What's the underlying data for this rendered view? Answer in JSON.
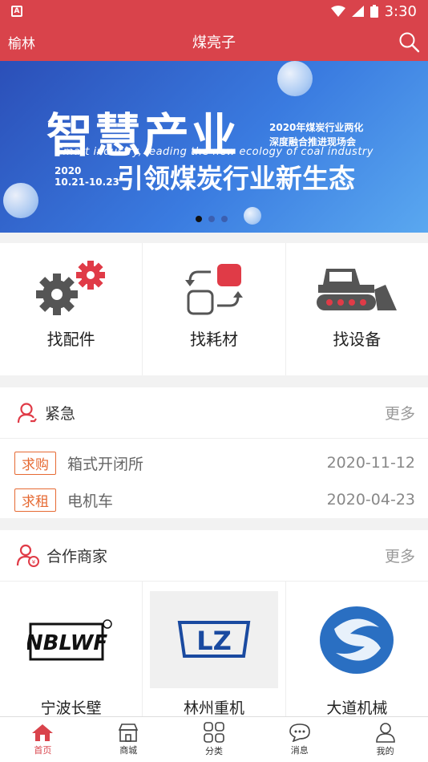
{
  "status_bar": {
    "time": "3:30"
  },
  "header": {
    "city": "榆林",
    "title": "煤亮子"
  },
  "banner": {
    "headline": "智慧产业",
    "sub_line1": "2020年煤炭行业两化",
    "sub_line2": "深度融合推进现场会",
    "english": "Smart industry, leading the new ecology of coal industry",
    "date_line1": "2020",
    "date_line2": "10.21-10.23",
    "headline2": "引领煤炭行业新生态",
    "slide_count": 3,
    "active_slide": 1
  },
  "categories": [
    {
      "label": "找配件",
      "icon": "gears-icon"
    },
    {
      "label": "找耗材",
      "icon": "swap-icon"
    },
    {
      "label": "找设备",
      "icon": "bulldozer-icon"
    }
  ],
  "urgent": {
    "title": "紧急",
    "more": "更多",
    "rows": [
      {
        "tag": "求购",
        "name": "箱式开闭所",
        "date": "2020-11-12"
      },
      {
        "tag": "求租",
        "name": "电机车",
        "date": "2020-04-23"
      }
    ]
  },
  "partners": {
    "title": "合作商家",
    "more": "更多",
    "items": [
      {
        "name": "宁波长壁",
        "logo_text": "NBLWF"
      },
      {
        "name": "林州重机",
        "logo_text": "LZ"
      },
      {
        "name": "大道机械",
        "logo_text": ""
      }
    ]
  },
  "tabbar": [
    {
      "label": "首页",
      "icon": "home-icon",
      "active": true
    },
    {
      "label": "商城",
      "icon": "shop-icon",
      "active": false
    },
    {
      "label": "分类",
      "icon": "grid-icon",
      "active": false
    },
    {
      "label": "消息",
      "icon": "chat-icon",
      "active": false
    },
    {
      "label": "我的",
      "icon": "user-icon",
      "active": false
    }
  ],
  "colors": {
    "brand": "#d9434b",
    "tag": "#e66a33",
    "banner": "#3a7be0"
  }
}
